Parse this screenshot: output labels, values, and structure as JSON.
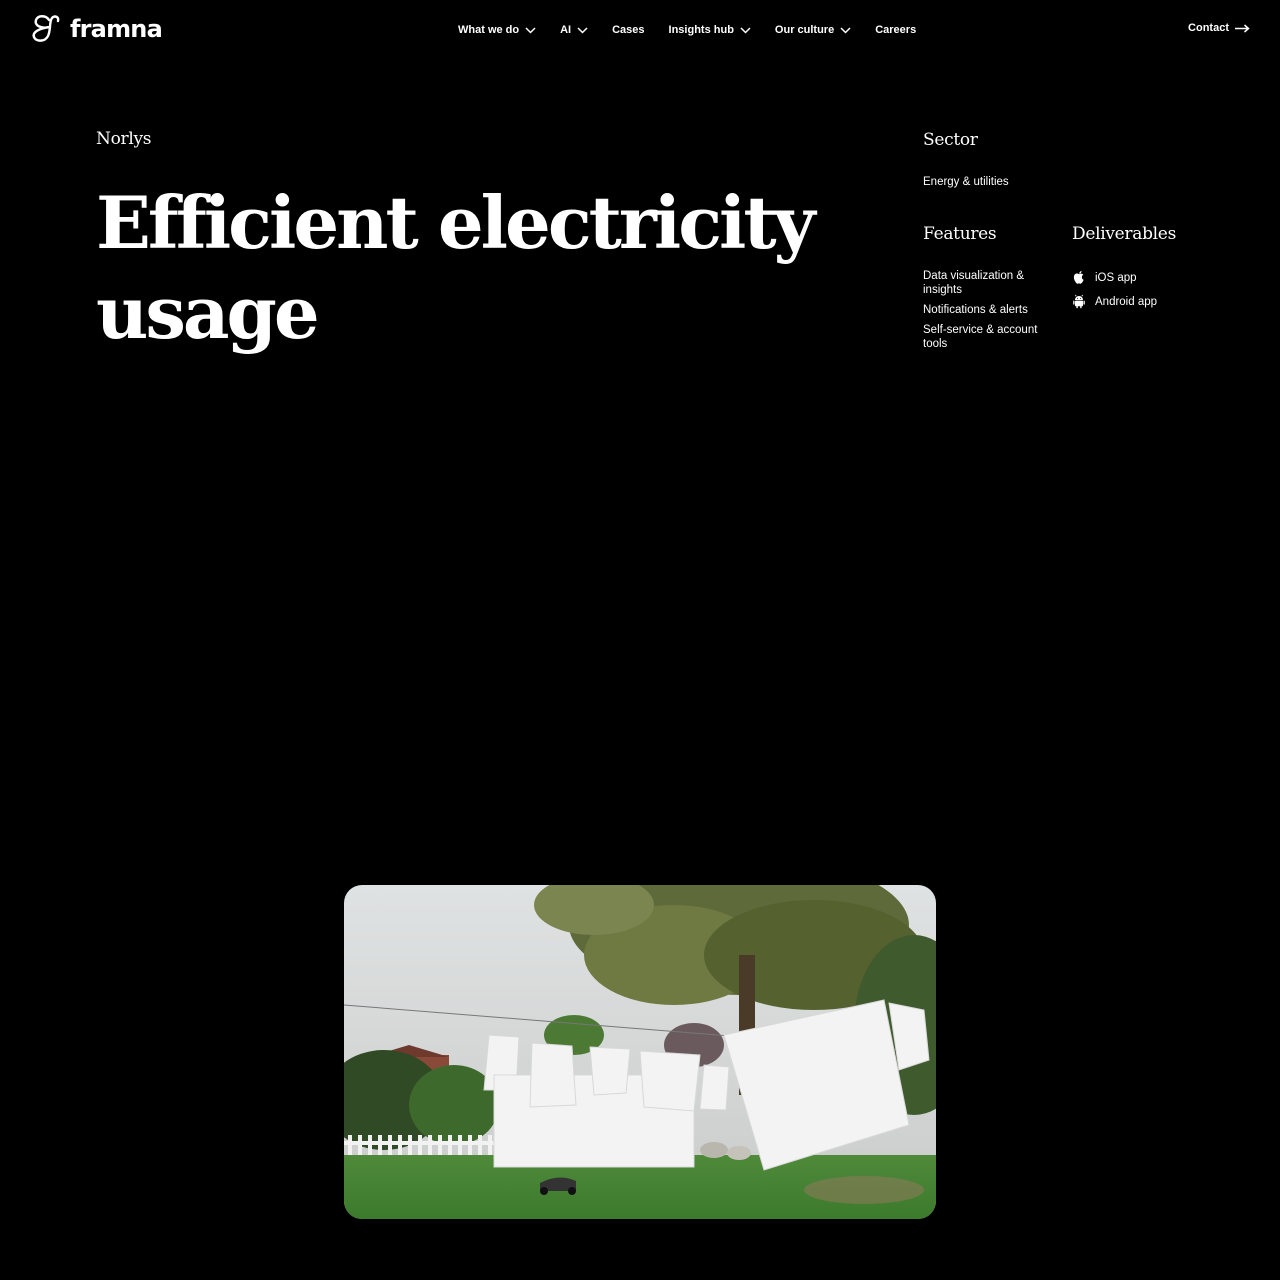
{
  "header": {
    "logo_text": "framna",
    "nav": [
      {
        "label": "What we do",
        "has_dropdown": true
      },
      {
        "label": "AI",
        "has_dropdown": true
      },
      {
        "label": "Cases",
        "has_dropdown": false
      },
      {
        "label": "Insights hub",
        "has_dropdown": true
      },
      {
        "label": "Our culture",
        "has_dropdown": true
      },
      {
        "label": "Careers",
        "has_dropdown": false
      }
    ],
    "contact_label": "Contact"
  },
  "case": {
    "client": "Norlys",
    "title_line1": "Efficient electricity",
    "title_line2": "usage"
  },
  "meta": {
    "sector_heading": "Sector",
    "sector_value": "Energy & utilities",
    "features_heading": "Features",
    "features": [
      "Data visualization & insights",
      "Notifications & alerts",
      "Self-service & account tools"
    ],
    "deliverables_heading": "Deliverables",
    "deliverables": [
      {
        "label": "iOS app",
        "icon": "apple-icon"
      },
      {
        "label": "Android app",
        "icon": "android-icon"
      }
    ]
  },
  "colors": {
    "background": "#000000",
    "text": "#ffffff"
  }
}
